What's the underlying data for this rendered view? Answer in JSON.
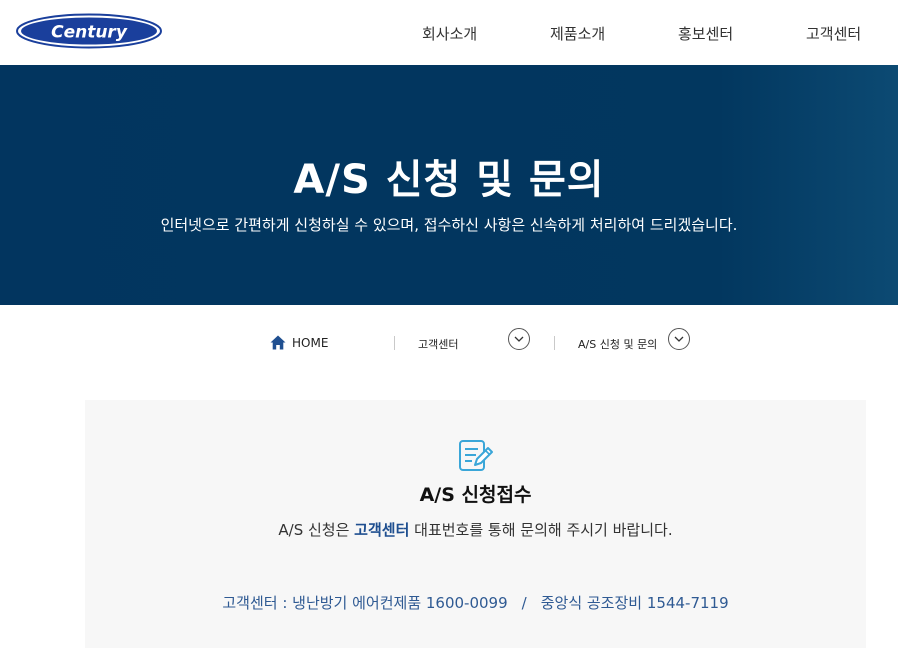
{
  "header": {
    "logo_text": "Century",
    "nav": [
      "회사소개",
      "제품소개",
      "홍보센터",
      "고객센터"
    ]
  },
  "hero": {
    "title": "A/S 신청 및 문의",
    "subtitle": "인터넷으로 간편하게 신청하실 수 있으며, 접수하신 사항은 신속하게 처리하여 드리겠습니다."
  },
  "breadcrumb": {
    "home": "HOME",
    "level1": "고객센터",
    "level2": "A/S 신청 및 문의"
  },
  "card": {
    "title": "A/S 신청접수",
    "desc_before": "A/S 신청은 ",
    "desc_highlight": "고객센터",
    "desc_after": " 대표번호를 통해 문의해 주시기 바랍니다.",
    "contact_1": "고객센터 : 냉난방기 에어컨제품 1600-0099",
    "contact_sep": "/",
    "contact_2": "중앙식 공조장비 1544-7119"
  },
  "colors": {
    "hero_bg": "#02355f",
    "accent": "#1f4f90",
    "icon": "#3aa6d8"
  }
}
